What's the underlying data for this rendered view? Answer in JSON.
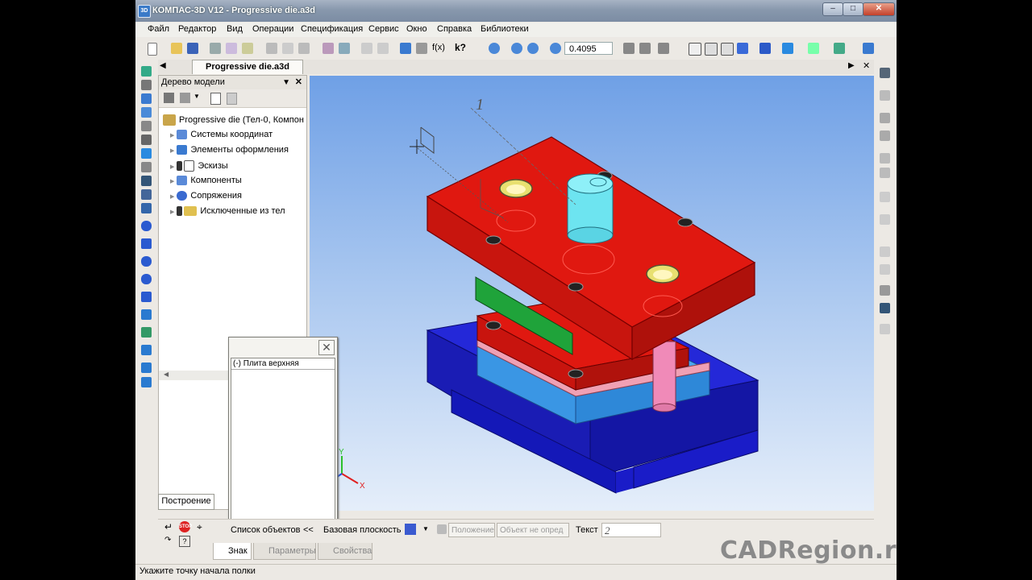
{
  "window": {
    "app_icon_text": "3D",
    "title": "КОМПАС-3D V12 - Progressive die.a3d"
  },
  "menu": [
    "Файл",
    "Редактор",
    "Вид",
    "Операции",
    "Спецификация",
    "Сервис",
    "Окно",
    "Справка",
    "Библиотеки"
  ],
  "toolbar": {
    "zoom_value": "0.4095",
    "fx_label": "f(x)",
    "help_label": "k?"
  },
  "document_tab": "Progressive die.a3d",
  "tree": {
    "header": "Дерево модели",
    "root": "Progressive die (Тел-0, Компон",
    "items": [
      "Системы координат",
      "Элементы оформления",
      "Эскизы",
      "Компоненты",
      "Сопряжения",
      "Исключенные из тел"
    ],
    "bottom_tab": "Построение"
  },
  "object_list_popup": {
    "item": "(-) Плита верхняя"
  },
  "viewport": {
    "leader_number": "1",
    "axis_y": "Y",
    "axis_x": "X",
    "colors": {
      "top_plate": "#d2140f",
      "punch": "#6de4f0",
      "green_plate": "#1fa33a",
      "base": "#1a1fcf",
      "light_blue": "#39a3ee",
      "guide_pin": "#f08ab8",
      "bushing": "#e8e070"
    }
  },
  "property_bar": {
    "object_list": "Список объектов",
    "collapse": "<<",
    "base_plane": "Базовая плоскость",
    "position": "Положение",
    "object_field": "Объект не опред",
    "text_label": "Текст",
    "text_value": "2"
  },
  "property_tabs": [
    "Знак",
    "Параметры",
    "Свойства"
  ],
  "status": "Укажите точку начала полки",
  "watermark": "CADRegion.ru"
}
